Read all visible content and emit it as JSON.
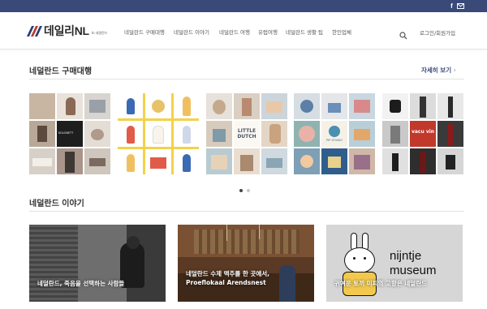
{
  "topbar": {
    "facebook_icon": "facebook-icon",
    "mail_icon": "mail-icon",
    "color": "#3a4a78"
  },
  "header": {
    "logo_text": "데일리NL",
    "logo_sub": "In 네덜란드",
    "logo_colors": [
      "#2c3e7a",
      "#c0392b",
      "#2c3e7a"
    ],
    "nav": [
      "네덜란드 구매대행",
      "네덜란드 이야기",
      "네덜란드 여행",
      "유럽여행",
      "네덜란드 생활 팁",
      "한인업체"
    ],
    "search_icon": "search-icon",
    "login": "로그인/회원가입"
  },
  "shopping": {
    "title": "네덜란드 구매대행",
    "more": "자세히 보기",
    "cards": [
      {
        "labels": [
          "",
          "",
          "",
          "",
          "",
          "KOLOBETT",
          "",
          "",
          ""
        ]
      },
      {
        "labels": [
          "",
          "",
          "",
          "",
          "",
          "",
          "",
          "",
          ""
        ]
      },
      {
        "labels": [
          "",
          "",
          "",
          "",
          "LITTLE DUTCH",
          "",
          "",
          "",
          ""
        ]
      },
      {
        "labels": [
          "",
          "",
          "",
          "",
          "PIP STUDIO",
          "",
          "",
          "",
          ""
        ]
      },
      {
        "labels": [
          "",
          "",
          "",
          "",
          "vacu vin",
          "",
          "",
          "",
          ""
        ]
      }
    ],
    "active_dot": 0,
    "dot_count": 2
  },
  "stories": {
    "title": "네덜란드 이야기",
    "items": [
      {
        "caption_line1": "네덜란드, 죽음을 선택하는 사람들",
        "caption_line2": ""
      },
      {
        "caption_line1": "네덜란드 수제 맥주를 한 곳에서,",
        "caption_line2": "Proeflokaal Arendsnest"
      },
      {
        "caption_line1": "귀여운 토끼 미피의 고향은 네덜란드",
        "caption_line2": "",
        "poster_line1": "nijntje",
        "poster_line2": "museum"
      }
    ]
  }
}
